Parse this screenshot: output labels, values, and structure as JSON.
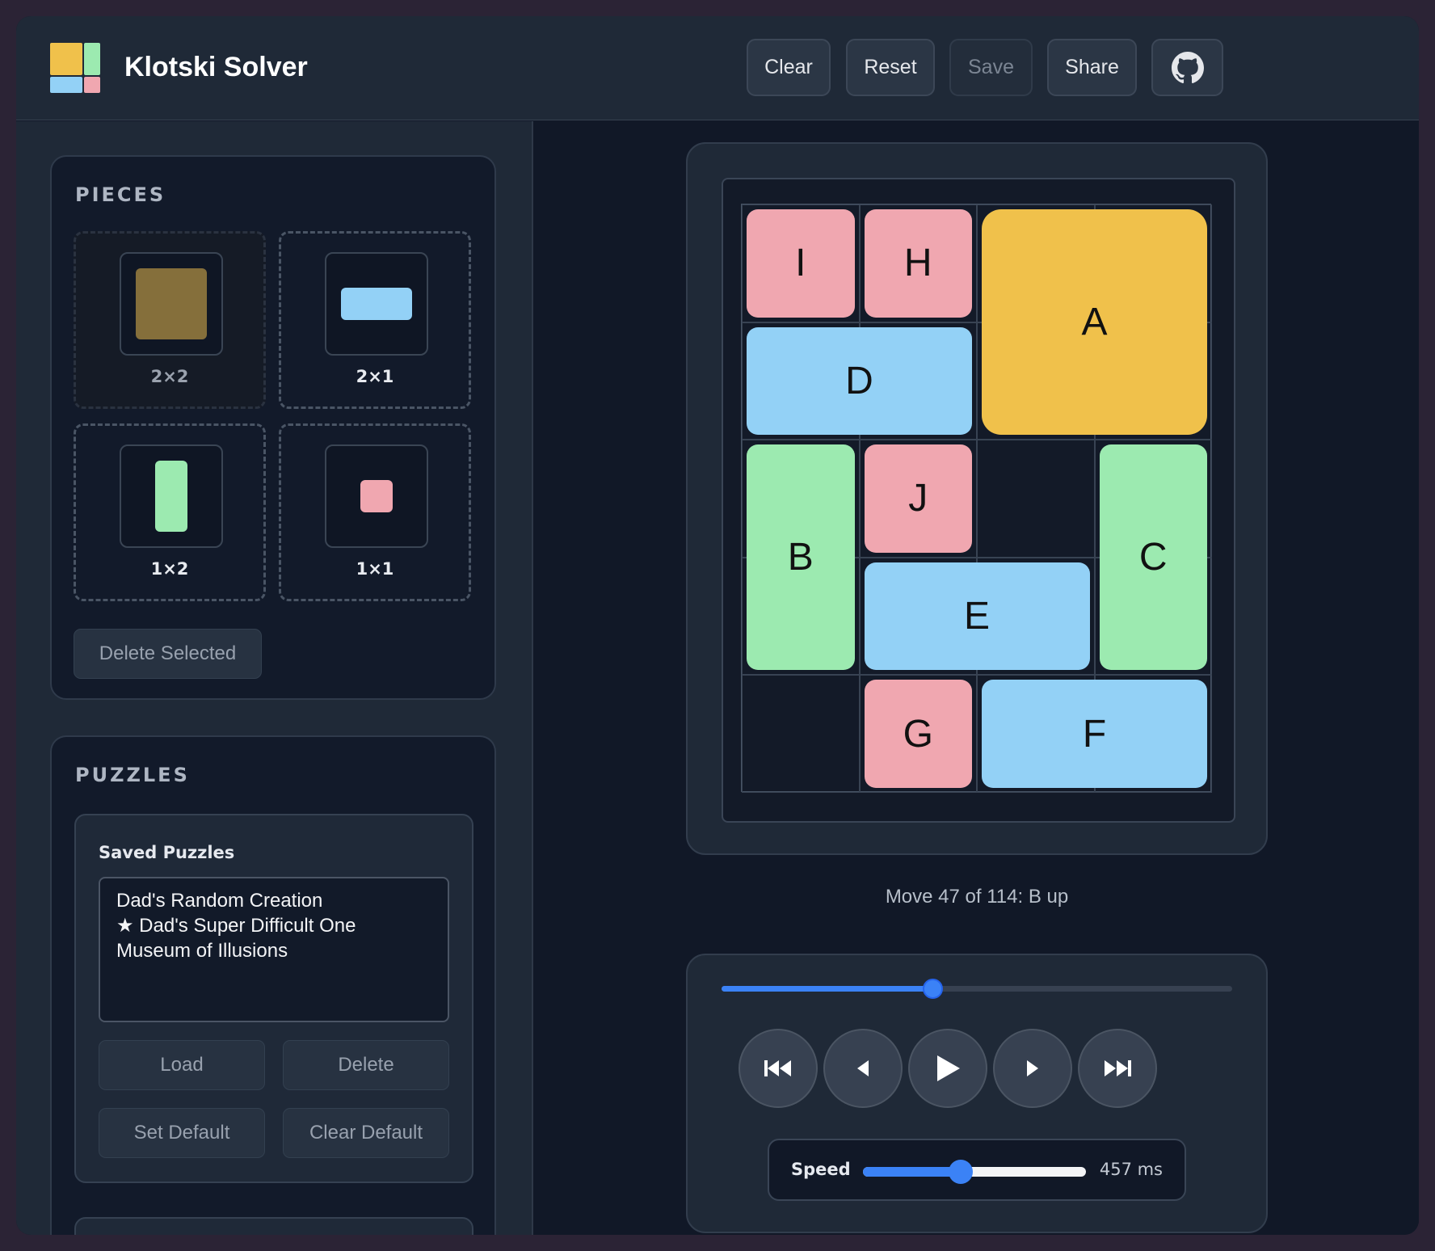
{
  "header": {
    "title": "Klotski Solver",
    "buttons": {
      "clear": "Clear",
      "reset": "Reset",
      "save": "Save",
      "share": "Share"
    },
    "github_icon": "github-icon",
    "logo_colors": [
      "#f0c14b",
      "#9ceab0",
      "#93d1f6",
      "#f0a7b0"
    ]
  },
  "pieces_panel": {
    "title": "PIECES",
    "pieces": [
      {
        "label": "2×2",
        "color": "#856f3b",
        "selected": true
      },
      {
        "label": "2×1",
        "color": "#93d1f6",
        "selected": false
      },
      {
        "label": "1×2",
        "color": "#9ceab0",
        "selected": false
      },
      {
        "label": "1×1",
        "color": "#f0a7b0",
        "selected": false
      }
    ],
    "delete_selected": "Delete Selected"
  },
  "puzzles_panel": {
    "title": "PUZZLES",
    "saved_title": "Saved Puzzles",
    "saved_list": [
      "Dad's Random Creation",
      "★ Dad's Super Difficult One",
      "Museum of Illusions"
    ],
    "buttons": {
      "load": "Load",
      "delete": "Delete",
      "set_default": "Set Default",
      "clear_default": "Clear Default"
    }
  },
  "board": {
    "columns": 4,
    "rows": 5,
    "blocks": [
      {
        "label": "I",
        "col": 0,
        "row": 0,
        "w": 1,
        "h": 1,
        "color": "#f0a7b0"
      },
      {
        "label": "H",
        "col": 1,
        "row": 0,
        "w": 1,
        "h": 1,
        "color": "#f0a7b0"
      },
      {
        "label": "A",
        "col": 2,
        "row": 0,
        "w": 2,
        "h": 2,
        "color": "#f0c14b"
      },
      {
        "label": "D",
        "col": 0,
        "row": 1,
        "w": 2,
        "h": 1,
        "color": "#93d1f6"
      },
      {
        "label": "B",
        "col": 0,
        "row": 2,
        "w": 1,
        "h": 2,
        "color": "#9ceab0"
      },
      {
        "label": "J",
        "col": 1,
        "row": 2,
        "w": 1,
        "h": 1,
        "color": "#f0a7b0"
      },
      {
        "label": "C",
        "col": 3,
        "row": 2,
        "w": 1,
        "h": 2,
        "color": "#9ceab0"
      },
      {
        "label": "E",
        "col": 1,
        "row": 3,
        "w": 2,
        "h": 1,
        "color": "#93d1f6"
      },
      {
        "label": "G",
        "col": 1,
        "row": 4,
        "w": 1,
        "h": 1,
        "color": "#f0a7b0"
      },
      {
        "label": "F",
        "col": 2,
        "row": 4,
        "w": 2,
        "h": 1,
        "color": "#93d1f6"
      }
    ]
  },
  "playback": {
    "move_text": "Move 47 of 114: B up",
    "current_move": 47,
    "total_moves": 114,
    "buttons": [
      "skip-to-start-icon",
      "step-back-icon",
      "play-icon",
      "step-forward-icon",
      "skip-to-end-icon"
    ],
    "speed_label": "Speed",
    "speed_value": "457 ms",
    "speed_fraction": 0.44
  }
}
